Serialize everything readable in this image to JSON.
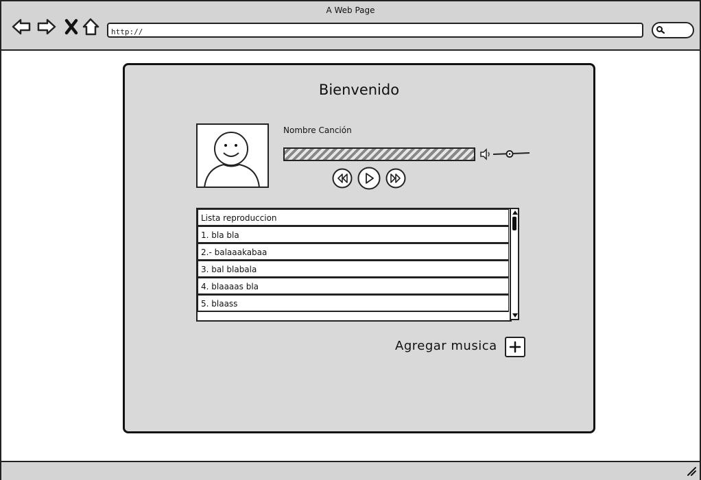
{
  "window": {
    "title": "A Web Page"
  },
  "toolbar": {
    "back_icon": "back-arrow-icon",
    "forward_icon": "forward-arrow-icon",
    "stop_icon": "close-x-icon",
    "home_icon": "home-icon",
    "address_value": "http://",
    "search_icon": "search-icon"
  },
  "page": {
    "heading": "Bienvenido",
    "avatar_icon": "user-avatar-icon",
    "player": {
      "song_name": "Nombre Canción",
      "progress": 1.0,
      "volume_icon": "speaker-icon",
      "rewind_icon": "rewind-icon",
      "play_icon": "play-icon",
      "fast_forward_icon": "fast-forward-icon"
    },
    "playlist": {
      "header": "Lista reproduccion",
      "items": [
        "1. bla bla",
        "2.- balaaakabaa",
        "3. bal blabala",
        "4. blaaaas bla",
        "5. blaass"
      ]
    },
    "add_music": {
      "label": "Agregar musica",
      "icon": "plus-icon"
    }
  },
  "colors": {
    "frame": "#d4d4d4",
    "card": "#d9d9d9",
    "ink": "#111111"
  }
}
